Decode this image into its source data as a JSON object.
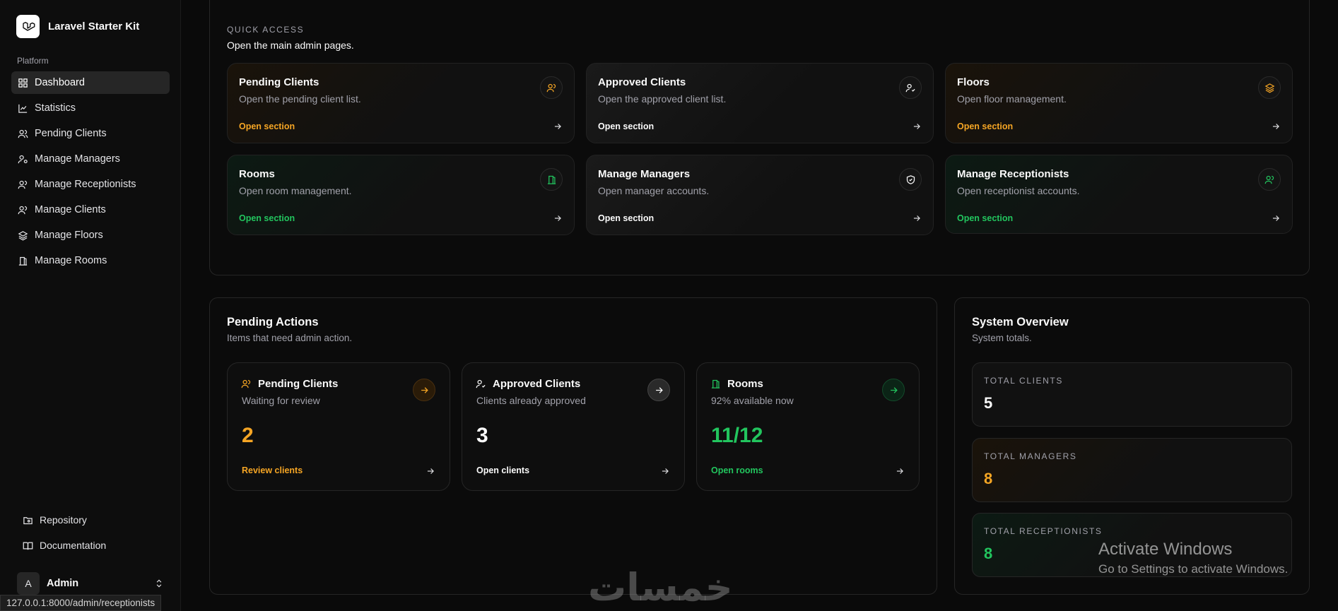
{
  "app": {
    "name": "Laravel Starter Kit"
  },
  "sidebar": {
    "group_label": "Platform",
    "items": [
      {
        "label": "Dashboard",
        "icon": "grid-icon"
      },
      {
        "label": "Statistics",
        "icon": "chart-icon"
      },
      {
        "label": "Pending Clients",
        "icon": "users-icon"
      },
      {
        "label": "Manage Managers",
        "icon": "user-cog-icon"
      },
      {
        "label": "Manage Receptionists",
        "icon": "users-icon"
      },
      {
        "label": "Manage Clients",
        "icon": "users-icon"
      },
      {
        "label": "Manage Floors",
        "icon": "layers-icon"
      },
      {
        "label": "Manage Rooms",
        "icon": "door-icon"
      }
    ],
    "footer": [
      {
        "label": "Repository",
        "icon": "folder-git-icon"
      },
      {
        "label": "Documentation",
        "icon": "book-icon"
      }
    ],
    "user": {
      "initial": "A",
      "name": "Admin"
    }
  },
  "status_url": "127.0.0.1:8000/admin/receptionists",
  "quick_access": {
    "eyebrow": "QUICK ACCESS",
    "subtitle": "Open the main admin pages.",
    "cards": [
      {
        "title": "Pending Clients",
        "desc": "Open the pending client list.",
        "link": "Open section",
        "tone": "orange",
        "icon": "users-icon"
      },
      {
        "title": "Approved Clients",
        "desc": "Open the approved client list.",
        "link": "Open section",
        "tone": "gray",
        "icon": "user-check-icon"
      },
      {
        "title": "Floors",
        "desc": "Open floor management.",
        "link": "Open section",
        "tone": "orange",
        "icon": "layers-icon"
      },
      {
        "title": "Rooms",
        "desc": "Open room management.",
        "link": "Open section",
        "tone": "green",
        "icon": "door-icon"
      },
      {
        "title": "Manage Managers",
        "desc": "Open manager accounts.",
        "link": "Open section",
        "tone": "gray",
        "icon": "shield-check-icon"
      },
      {
        "title": "Manage Receptionists",
        "desc": "Open receptionist accounts.",
        "link": "Open section",
        "tone": "green",
        "icon": "users-icon"
      }
    ]
  },
  "pending_actions": {
    "title": "Pending Actions",
    "subtitle": "Items that need admin action.",
    "cards": [
      {
        "title": "Pending Clients",
        "desc": "Waiting for review",
        "value": "2",
        "link": "Review clients",
        "tone": "orange"
      },
      {
        "title": "Approved Clients",
        "desc": "Clients already approved",
        "value": "3",
        "link": "Open clients",
        "tone": "white"
      },
      {
        "title": "Rooms",
        "desc": "92% available now",
        "value": "11/12",
        "link": "Open rooms",
        "tone": "green"
      }
    ]
  },
  "system_overview": {
    "title": "System Overview",
    "subtitle": "System totals.",
    "cards": [
      {
        "label": "TOTAL CLIENTS",
        "value": "5",
        "tone": "white"
      },
      {
        "label": "TOTAL MANAGERS",
        "value": "8",
        "tone": "orange"
      },
      {
        "label": "TOTAL RECEPTIONISTS",
        "value": "8",
        "tone": "green"
      }
    ]
  },
  "watermark": {
    "title": "Activate Windows",
    "subtitle": "Go to Settings to activate Windows.",
    "logo": "خمسات"
  },
  "colors": {
    "orange": "#f5a524",
    "green": "#22c55e",
    "background": "#0a0a0a"
  }
}
